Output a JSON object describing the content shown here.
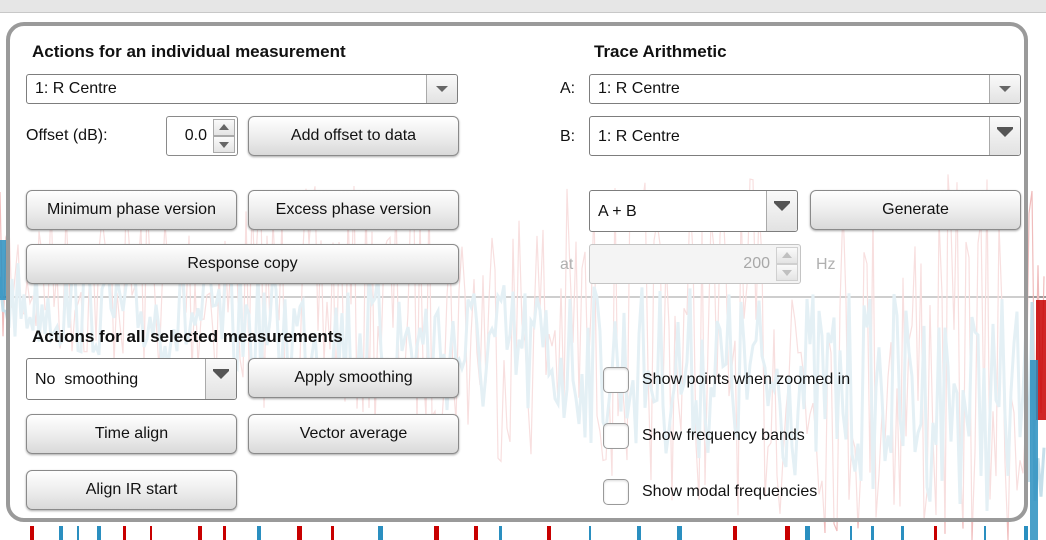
{
  "individual": {
    "heading": "Actions for an individual measurement",
    "measurement_select": "1: R Centre",
    "offset_label": "Offset (dB):",
    "offset_value": "0.0",
    "add_offset_button": "Add offset to data",
    "min_phase_button": "Minimum phase version",
    "excess_phase_button": "Excess phase version",
    "response_copy_button": "Response copy"
  },
  "trace_arithmetic": {
    "heading": "Trace Arithmetic",
    "a_label": "A:",
    "a_value": "1: R Centre",
    "b_label": "B:",
    "b_value": "1: R Centre",
    "operation_value": "A + B",
    "generate_button": "Generate",
    "at_label": "at",
    "frequency_value": "200",
    "frequency_unit": "Hz"
  },
  "all_selected": {
    "heading": "Actions for all selected measurements",
    "smoothing_select": "No  smoothing",
    "apply_smoothing_button": "Apply smoothing",
    "time_align_button": "Time align",
    "vector_average_button": "Vector average",
    "align_ir_button": "Align IR start"
  },
  "options": {
    "show_points": {
      "label": "Show points when zoomed in",
      "checked": false
    },
    "show_bands": {
      "label": "Show frequency bands",
      "checked": false
    },
    "show_modal": {
      "label": "Show modal frequencies",
      "checked": false
    }
  },
  "colors": {
    "blue_trace": "#2a8fc0",
    "blue_trace_faded": "#c6dfea",
    "red_trace": "#c80000",
    "red_trace_faded": "#f0bcbc"
  }
}
